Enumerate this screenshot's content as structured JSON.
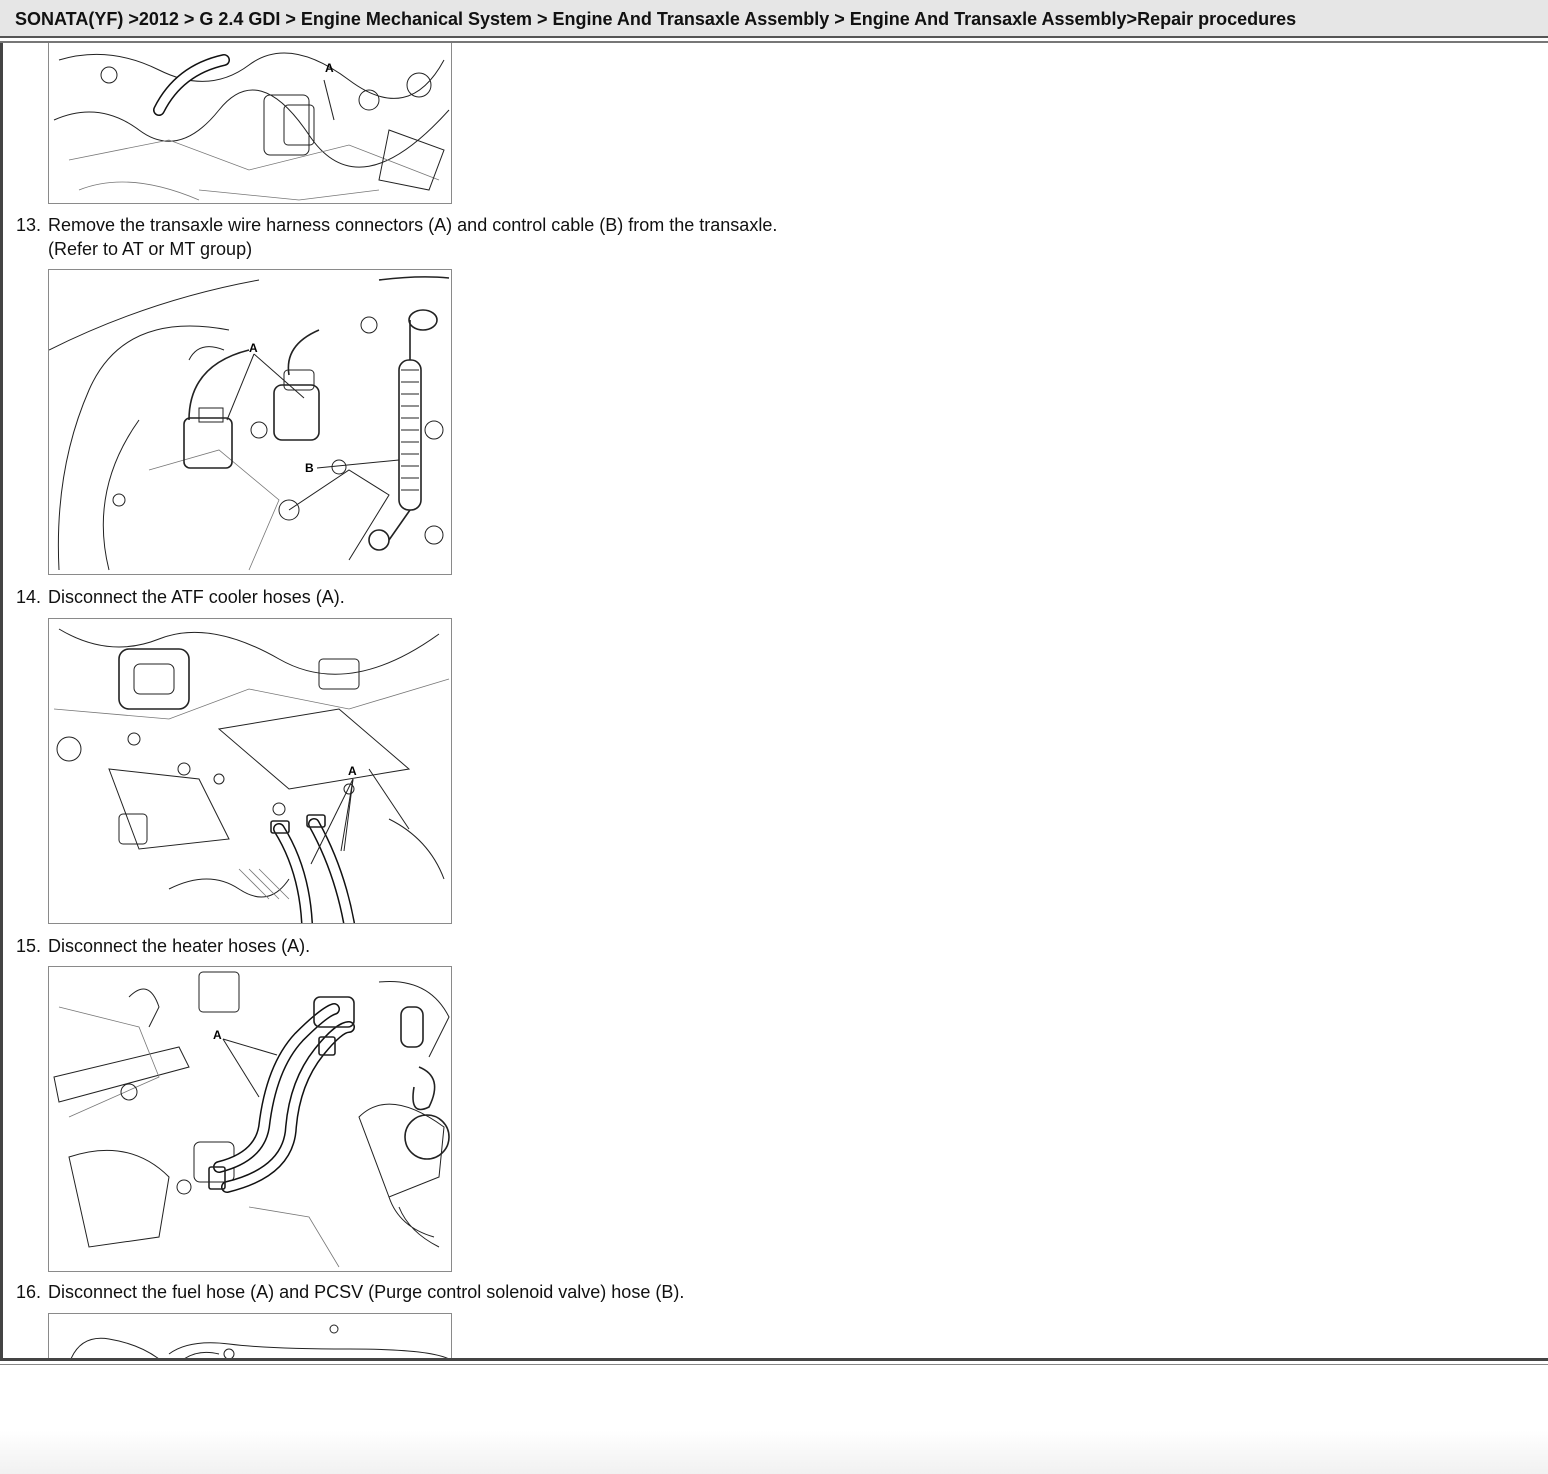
{
  "header": {
    "breadcrumb": "SONATA(YF) >2012 > G 2.4 GDI > Engine Mechanical System > Engine And Transaxle Assembly > Engine And Transaxle Assembly>Repair procedures"
  },
  "steps": [
    {
      "number": "13.",
      "text": "Remove the transaxle wire harness connectors (A) and control cable (B) from the transaxle.",
      "note": "(Refer to AT or MT group)",
      "figure_callouts": [
        "A",
        "B"
      ]
    },
    {
      "number": "14.",
      "text": "Disconnect the ATF cooler hoses (A).",
      "figure_callouts": [
        "A"
      ]
    },
    {
      "number": "15.",
      "text": "Disconnect the heater hoses (A).",
      "figure_callouts": [
        "A"
      ]
    },
    {
      "number": "16.",
      "text": "Disconnect the fuel hose (A) and PCSV (Purge control solenoid valve) hose (B).",
      "figure_callouts": [
        "A"
      ]
    }
  ],
  "top_figure": {
    "figure_callouts": [
      "A"
    ]
  }
}
